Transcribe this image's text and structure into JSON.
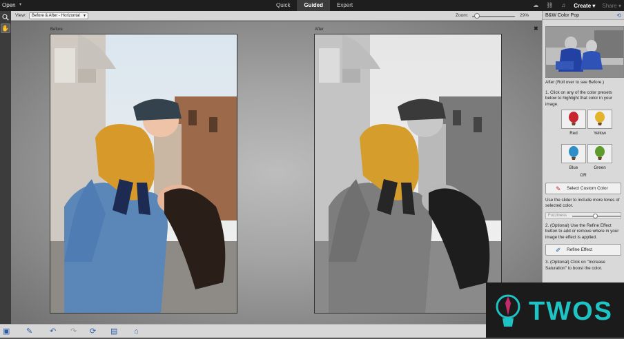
{
  "topbar": {
    "open_label": "Open",
    "tabs": [
      {
        "label": "Quick",
        "active": false
      },
      {
        "label": "Guided",
        "active": true
      },
      {
        "label": "Expert",
        "active": false
      }
    ],
    "create_label": "Create",
    "share_label": "Share"
  },
  "options": {
    "view_label": "View:",
    "view_value": "Before & After - Horizontal",
    "zoom_label": "Zoom:",
    "zoom_value": "29%"
  },
  "canvas": {
    "before_label": "Before",
    "after_label": "After"
  },
  "panel": {
    "title": "B&W Color Pop",
    "after_note": "After (Roll over to see Before.)",
    "step1": "1. Click on any of the color presets below to highlight that color in your image.",
    "presets": [
      {
        "label": "Red",
        "color": "#c8262f"
      },
      {
        "label": "Yellow",
        "color": "#e3b32a"
      },
      {
        "label": "Blue",
        "color": "#2f8ec8"
      },
      {
        "label": "Green",
        "color": "#5e9a2c"
      }
    ],
    "or_label": "OR",
    "custom_color_label": "Select Custom Color",
    "slider_note": "Use the slider to include more tones of selected color.",
    "fuzziness_label": "Fuzziness",
    "fuzziness_level": 0.45,
    "step2": "2. (Optional) Use the Refine Effect button to add or remove where in your image the effect is applied.",
    "refine_label": "Refine Effect",
    "step3": "3. (Optional) Click on \"Increase Saturation\" to boost the color."
  },
  "colors": {
    "accent": "#2c5ea8",
    "topbar_bg": "#1e1e1e"
  }
}
